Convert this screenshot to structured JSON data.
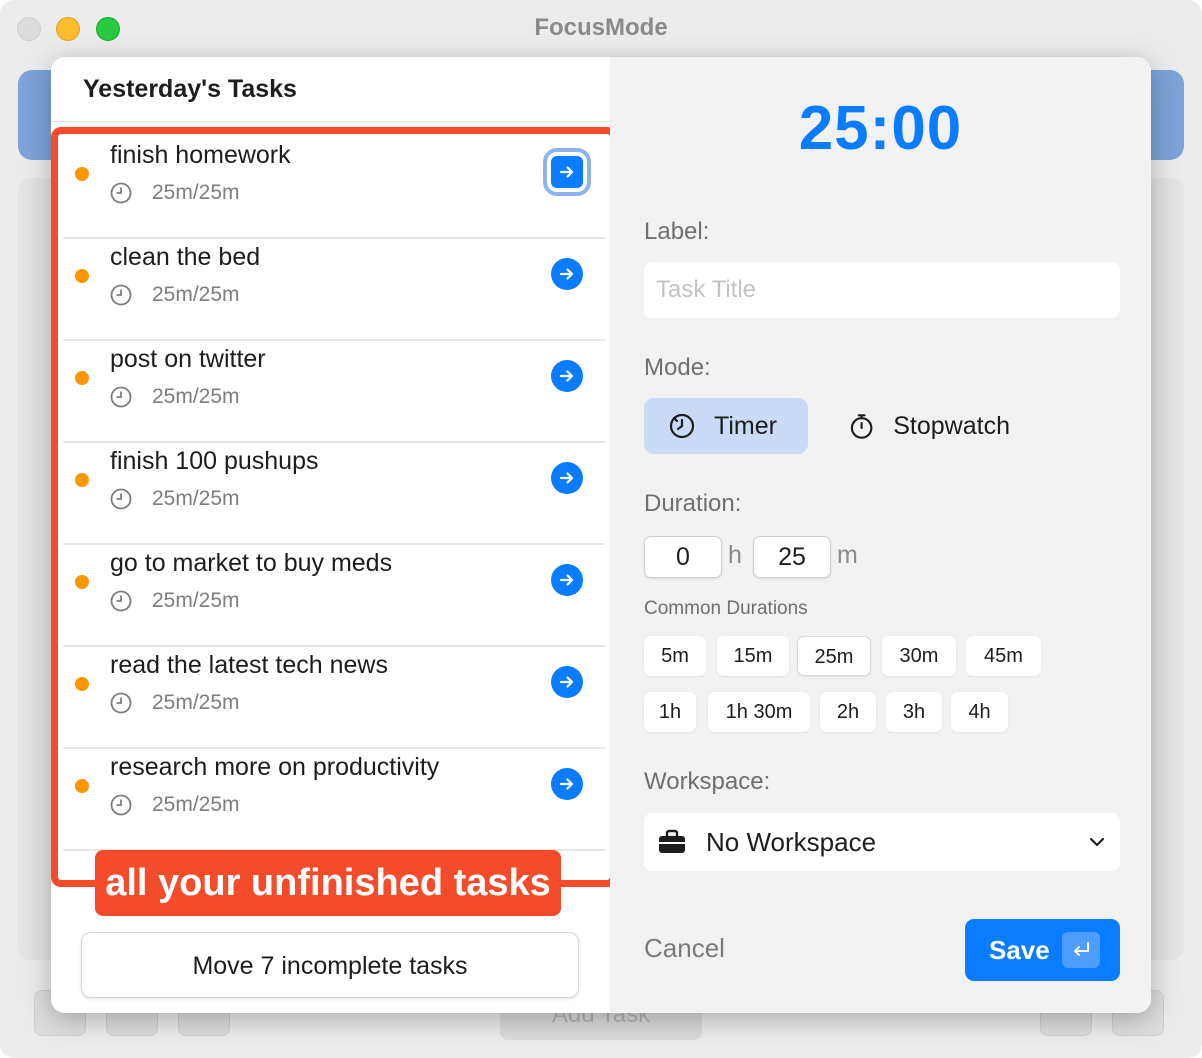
{
  "window": {
    "title": "FocusMode"
  },
  "background": {
    "add_task_label": "Add Task"
  },
  "left_panel": {
    "title": "Yesterday's Tasks",
    "tasks": [
      {
        "name": "finish homework",
        "progress": "25m/25m"
      },
      {
        "name": "clean the bed",
        "progress": "25m/25m"
      },
      {
        "name": "post on twitter",
        "progress": "25m/25m"
      },
      {
        "name": "finish 100 pushups",
        "progress": "25m/25m"
      },
      {
        "name": "go to market to buy meds",
        "progress": "25m/25m"
      },
      {
        "name": "read the latest tech news",
        "progress": "25m/25m"
      },
      {
        "name": "research more on productivity",
        "progress": "25m/25m"
      }
    ],
    "callout": "all your unfinished tasks",
    "move_button": "Move 7 incomplete tasks"
  },
  "right_panel": {
    "timer": "25:00",
    "label_heading": "Label:",
    "title_placeholder": "Task Title",
    "mode_heading": "Mode:",
    "modes": {
      "timer": "Timer",
      "stopwatch": "Stopwatch"
    },
    "duration_heading": "Duration:",
    "duration": {
      "hours": "0",
      "hours_unit": "h",
      "minutes": "25",
      "minutes_unit": "m"
    },
    "common_durations_heading": "Common Durations",
    "common_durations_row1": [
      "5m",
      "15m",
      "25m",
      "30m",
      "45m"
    ],
    "common_durations_row2": [
      "1h",
      "1h 30m",
      "2h",
      "3h",
      "4h"
    ],
    "workspace_heading": "Workspace:",
    "workspace_value": "No Workspace",
    "cancel": "Cancel",
    "save": "Save"
  },
  "colors": {
    "accent": "#0a7cff",
    "task_dot": "#ff9500",
    "highlight": "#f44b2a"
  }
}
